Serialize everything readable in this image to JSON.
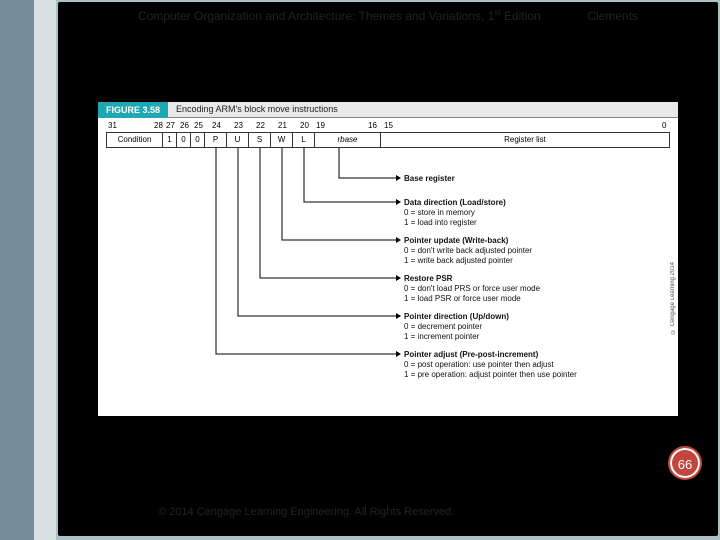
{
  "header": {
    "title_pre": "Computer Organization and Architecture: Themes and Variations, 1",
    "title_sup": "st",
    "title_post": " Edition",
    "author": "Clements"
  },
  "figure": {
    "label": "FIGURE 3.58",
    "caption": "Encoding ARM's block move instructions",
    "bits": {
      "b31": "31",
      "b28": "28",
      "b27": "27",
      "b26": "26",
      "b25": "25",
      "b24": "24",
      "b23": "23",
      "b22": "22",
      "b21": "21",
      "b20": "20",
      "b19": "19",
      "b16": "16",
      "b15": "15",
      "b0": "0"
    },
    "cells": {
      "cond": "Condition",
      "c1": "1",
      "c0a": "0",
      "c0b": "0",
      "cP": "P",
      "cU": "U",
      "cS": "S",
      "cW": "W",
      "cL": "L",
      "rbase": "rbase",
      "reglist": "Register list"
    },
    "desc": {
      "base": "Base register",
      "dir_t": "Data direction (Load/store)",
      "dir_0": "0 = store in memory",
      "dir_1": "1 = load into register",
      "upd_t": "Pointer update (Write-back)",
      "upd_0": "0 = don't write back adjusted pointer",
      "upd_1": "1 = write back adjusted pointer",
      "psr_t": "Restore PSR",
      "psr_0": "0 = don't load PRS or force user mode",
      "psr_1": "1 = load PSR or force user mode",
      "ud_t": "Pointer direction (Up/down)",
      "ud_0": "0 = decrement pointer",
      "ud_1": "1 = increment pointer",
      "adj_t": "Pointer adjust (Pre-post-increment)",
      "adj_0": "0 = post operation: use pointer then adjust",
      "adj_1": "1 = pre operation: adjust pointer then use pointer"
    },
    "side_credit": "© Cengage Learning 2014"
  },
  "page_number": "66",
  "footer": "© 2014 Cengage Learning Engineering. All Rights Reserved."
}
